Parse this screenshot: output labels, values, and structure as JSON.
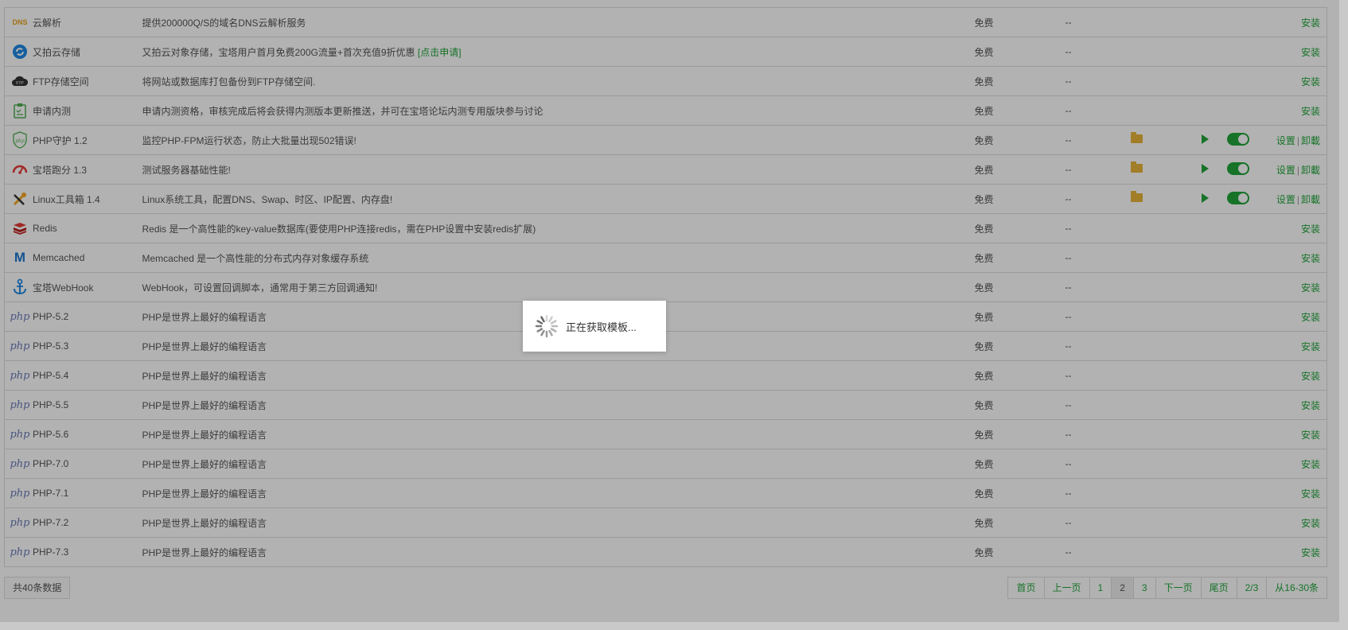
{
  "plugins": [
    {
      "icon": "dns-icon",
      "icon_text": "DNS",
      "name": "云解析",
      "desc": "提供200000Q/S的域名DNS云解析服务",
      "price": "免费",
      "expire": "--",
      "installed": false,
      "op": "安装"
    },
    {
      "icon": "upyun-icon",
      "name": "又拍云存储",
      "desc": "又拍云对象存储，宝塔用户首月免费200G流量+首次充值9折优惠",
      "desc_link": "[点击申请]",
      "price": "免费",
      "expire": "--",
      "installed": false,
      "op": "安装"
    },
    {
      "icon": "ftp-cloud-icon",
      "icon_text": "FTP",
      "name": "FTP存储空间",
      "desc": "将网站或数据库打包备份到FTP存储空间.",
      "price": "免费",
      "expire": "--",
      "installed": false,
      "op": "安装"
    },
    {
      "icon": "beta-apply-icon",
      "name": "申请内测",
      "desc": "申请内测资格，审核完成后将会获得内测版本更新推送，并可在宝塔论坛内测专用版块参与讨论",
      "price": "免费",
      "expire": "--",
      "installed": false,
      "op": "安装"
    },
    {
      "icon": "php-guard-icon",
      "icon_text": "php",
      "name": "PHP守护 1.2",
      "desc": "监控PHP-FPM运行状态，防止大批量出现502错误!",
      "price": "免费",
      "expire": "--",
      "installed": true,
      "op_set": "设置",
      "op_sep": "|",
      "op_uninstall": "卸載"
    },
    {
      "icon": "speedometer-icon",
      "name": "宝塔跑分 1.3",
      "desc": "测试服务器基础性能!",
      "price": "免费",
      "expire": "--",
      "installed": true,
      "op_set": "设置",
      "op_sep": "|",
      "op_uninstall": "卸載"
    },
    {
      "icon": "tools-icon",
      "name": "Linux工具箱 1.4",
      "desc": "Linux系统工具，配置DNS、Swap、时区、IP配置、内存盘!",
      "price": "免费",
      "expire": "--",
      "installed": true,
      "op_set": "设置",
      "op_sep": "|",
      "op_uninstall": "卸載"
    },
    {
      "icon": "redis-icon",
      "name": "Redis",
      "desc": "Redis 是一个高性能的key-value数据库(要使用PHP连接redis，需在PHP设置中安装redis扩展)",
      "price": "免费",
      "expire": "--",
      "installed": false,
      "op": "安装"
    },
    {
      "icon": "memcached-icon",
      "icon_text": "M",
      "name": "Memcached",
      "desc": "Memcached 是一个高性能的分布式内存对象缓存系统",
      "price": "免费",
      "expire": "--",
      "installed": false,
      "op": "安装"
    },
    {
      "icon": "webhook-icon",
      "name": "宝塔WebHook",
      "desc": "WebHook，可设置回调脚本，通常用于第三方回调通知!",
      "price": "免费",
      "expire": "--",
      "installed": false,
      "op": "安装"
    },
    {
      "icon": "php-icon",
      "icon_text": "php",
      "name": "PHP-5.2",
      "desc": "PHP是世界上最好的编程语言",
      "price": "免费",
      "expire": "--",
      "installed": false,
      "op": "安装"
    },
    {
      "icon": "php-icon",
      "icon_text": "php",
      "name": "PHP-5.3",
      "desc": "PHP是世界上最好的编程语言",
      "price": "免费",
      "expire": "--",
      "installed": false,
      "op": "安装"
    },
    {
      "icon": "php-icon",
      "icon_text": "php",
      "name": "PHP-5.4",
      "desc": "PHP是世界上最好的编程语言",
      "price": "免费",
      "expire": "--",
      "installed": false,
      "op": "安装"
    },
    {
      "icon": "php-icon",
      "icon_text": "php",
      "name": "PHP-5.5",
      "desc": "PHP是世界上最好的编程语言",
      "price": "免费",
      "expire": "--",
      "installed": false,
      "op": "安装"
    },
    {
      "icon": "php-icon",
      "icon_text": "php",
      "name": "PHP-5.6",
      "desc": "PHP是世界上最好的编程语言",
      "price": "免费",
      "expire": "--",
      "installed": false,
      "op": "安装"
    },
    {
      "icon": "php-icon",
      "icon_text": "php",
      "name": "PHP-7.0",
      "desc": "PHP是世界上最好的编程语言",
      "price": "免费",
      "expire": "--",
      "installed": false,
      "op": "安装"
    },
    {
      "icon": "php-icon",
      "icon_text": "php",
      "name": "PHP-7.1",
      "desc": "PHP是世界上最好的编程语言",
      "price": "免费",
      "expire": "--",
      "installed": false,
      "op": "安装"
    },
    {
      "icon": "php-icon",
      "icon_text": "php",
      "name": "PHP-7.2",
      "desc": "PHP是世界上最好的编程语言",
      "price": "免费",
      "expire": "--",
      "installed": false,
      "op": "安装"
    },
    {
      "icon": "php-icon",
      "icon_text": "php",
      "name": "PHP-7.3",
      "desc": "PHP是世界上最好的编程语言",
      "price": "免费",
      "expire": "--",
      "installed": false,
      "op": "安装"
    }
  ],
  "footer": {
    "total": "共40条数据",
    "pager": {
      "first": "首页",
      "prev": "上一页",
      "pages": [
        "1",
        "2",
        "3"
      ],
      "current_page": "2",
      "next": "下一页",
      "last": "尾页",
      "page_info": "2/3",
      "range": "从16-30条"
    }
  },
  "loading": {
    "text": "正在获取模板..."
  },
  "colors": {
    "accent": "#20a53a",
    "folder": "#e8b53a",
    "overlay": "rgba(0,0,0,0.3)"
  }
}
